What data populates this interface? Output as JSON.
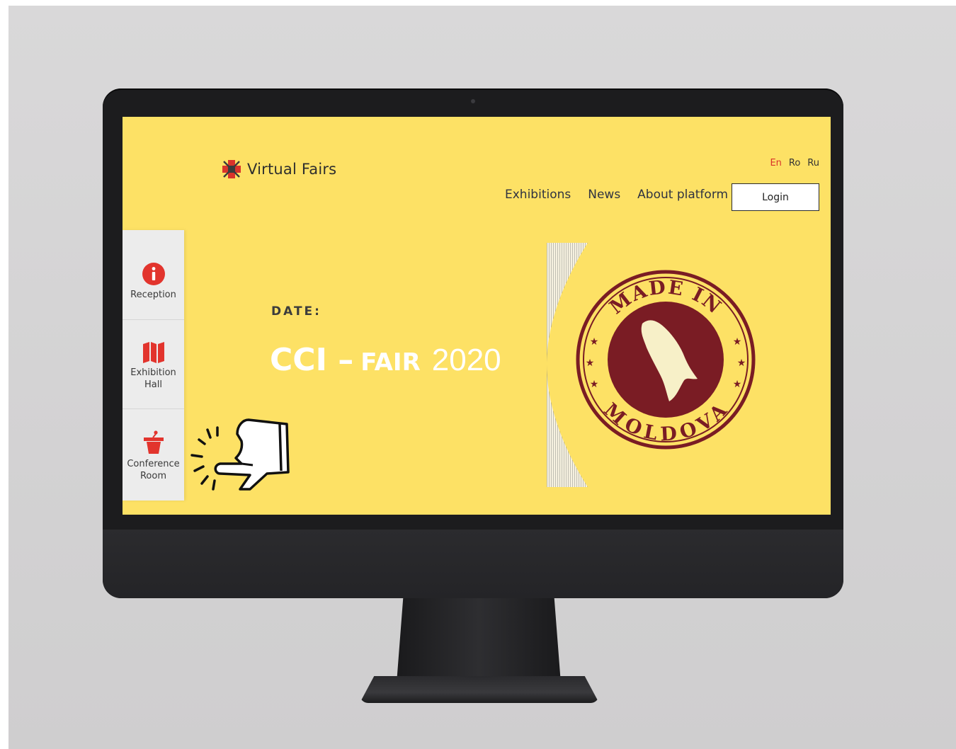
{
  "brand": {
    "name": "Virtual Fairs",
    "logo_icon": "virtual-fairs-logo-icon"
  },
  "languages": [
    {
      "code": "En",
      "active": true
    },
    {
      "code": "Ro",
      "active": false
    },
    {
      "code": "Ru",
      "active": false
    }
  ],
  "nav": {
    "items": [
      "Exhibitions",
      "News",
      "About platform"
    ],
    "login_label": "Login"
  },
  "sidebar": {
    "items": [
      {
        "label": "Reception",
        "icon": "info-icon"
      },
      {
        "label": "Exhibition\nHall",
        "icon": "map-icon"
      },
      {
        "label": "Conference\nRoom",
        "icon": "podium-icon"
      }
    ]
  },
  "hero": {
    "date_label": "DATE:",
    "title_part1": "CCI –",
    "title_part2": "FAIR",
    "title_part3": "2020"
  },
  "stamp": {
    "top_text": "MADE IN",
    "bottom_text": "MOLDOVA"
  },
  "colors": {
    "screen_bg": "#fde165",
    "accent_red": "#d9342b",
    "stamp_color": "#7a1c24",
    "nav_text": "#2f3341"
  }
}
